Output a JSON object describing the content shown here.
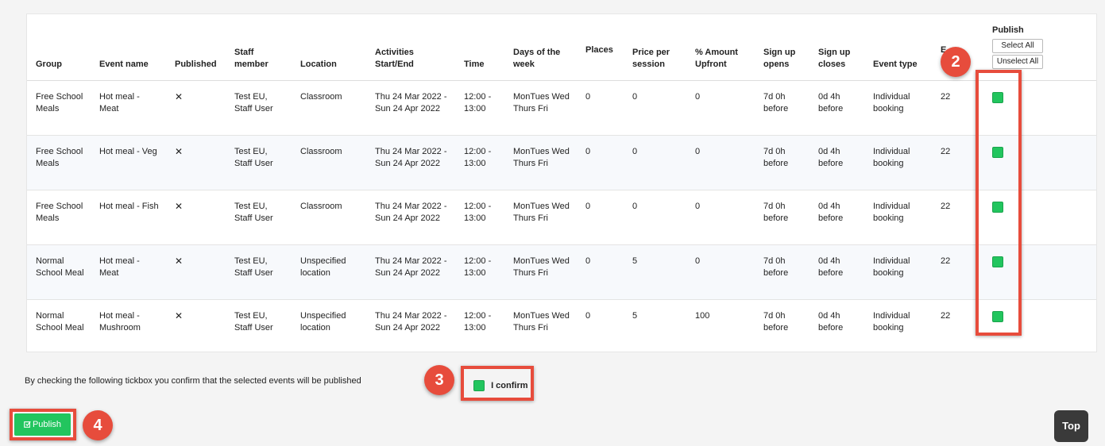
{
  "table": {
    "headers": {
      "group": "Group",
      "event_name": "Event name",
      "published": "Published",
      "staff_line1": "Staff",
      "staff_line2": "member",
      "location": "Location",
      "activities_line1": "Activities",
      "activities_line2": "Start/End",
      "time": "Time",
      "days_line1": "Days of the",
      "days_line2": "week",
      "places": "Places",
      "price_line1": "Price per",
      "price_line2": "session",
      "amount_line1": "% Amount",
      "amount_line2": "Upfront",
      "signup_opens_line1": "Sign up",
      "signup_opens_line2": "opens",
      "signup_closes_line1": "Sign up",
      "signup_closes_line2": "closes",
      "event_type": "Event type",
      "extra_partial": "E",
      "publish": "Publish"
    },
    "select_all": "Select All",
    "unselect_all": "Unselect All",
    "rows": [
      {
        "group": "Free School Meals",
        "event_name": "Hot meal - Meat",
        "published": "✕",
        "staff": "Test EU, Staff User",
        "location": "Classroom",
        "dates": "Thu 24 Mar 2022 - Sun 24 Apr 2022",
        "time": "12:00 - 13:00",
        "days": "MonTues Wed Thurs Fri",
        "places": "0",
        "price": "0",
        "upfront": "0",
        "opens": "7d 0h before",
        "closes": "0d 4h before",
        "event_type": "Individual booking",
        "extra": "22",
        "publish_checked": true
      },
      {
        "group": "Free School Meals",
        "event_name": "Hot meal - Veg",
        "published": "✕",
        "staff": "Test EU, Staff User",
        "location": "Classroom",
        "dates": "Thu 24 Mar 2022 - Sun 24 Apr 2022",
        "time": "12:00 - 13:00",
        "days": "MonTues Wed Thurs Fri",
        "places": "0",
        "price": "0",
        "upfront": "0",
        "opens": "7d 0h before",
        "closes": "0d 4h before",
        "event_type": "Individual booking",
        "extra": "22",
        "publish_checked": true
      },
      {
        "group": "Free School Meals",
        "event_name": "Hot meal - Fish",
        "published": "✕",
        "staff": "Test EU, Staff User",
        "location": "Classroom",
        "dates": "Thu 24 Mar 2022 - Sun 24 Apr 2022",
        "time": "12:00 - 13:00",
        "days": "MonTues Wed Thurs Fri",
        "places": "0",
        "price": "0",
        "upfront": "0",
        "opens": "7d 0h before",
        "closes": "0d 4h before",
        "event_type": "Individual booking",
        "extra": "22",
        "publish_checked": true
      },
      {
        "group": "Normal School Meal",
        "event_name": "Hot meal - Meat",
        "published": "✕",
        "staff": "Test EU, Staff User",
        "location": "Unspecified location",
        "dates": "Thu 24 Mar 2022 - Sun 24 Apr 2022",
        "time": "12:00 - 13:00",
        "days": "MonTues Wed Thurs Fri",
        "places": "0",
        "price": "5",
        "upfront": "0",
        "opens": "7d 0h before",
        "closes": "0d 4h before",
        "event_type": "Individual booking",
        "extra": "22",
        "publish_checked": true
      },
      {
        "group": "Normal School Meal",
        "event_name": "Hot meal - Mushroom",
        "published": "✕",
        "staff": "Test EU, Staff User",
        "location": "Unspecified location",
        "dates": "Thu 24 Mar 2022 - Sun 24 Apr 2022",
        "time": "12:00 - 13:00",
        "days": "MonTues Wed Thurs Fri",
        "places": "0",
        "price": "5",
        "upfront": "100",
        "opens": "7d 0h before",
        "closes": "0d 4h before",
        "event_type": "Individual booking",
        "extra": "22",
        "publish_checked": true
      }
    ]
  },
  "confirm": {
    "text": "By checking the following tickbox you confirm that the selected events will be published",
    "label": "I confirm",
    "checked": true
  },
  "publish_button": {
    "icon": "edit-check-icon",
    "label": "Publish"
  },
  "top_button": {
    "label": "Top"
  },
  "annotations": {
    "step2": "2",
    "step3": "3",
    "step4": "4",
    "color": "#e74c3c"
  },
  "colors": {
    "checkbox_green": "#22c55e",
    "top_button_bg": "#3a3a3a"
  }
}
